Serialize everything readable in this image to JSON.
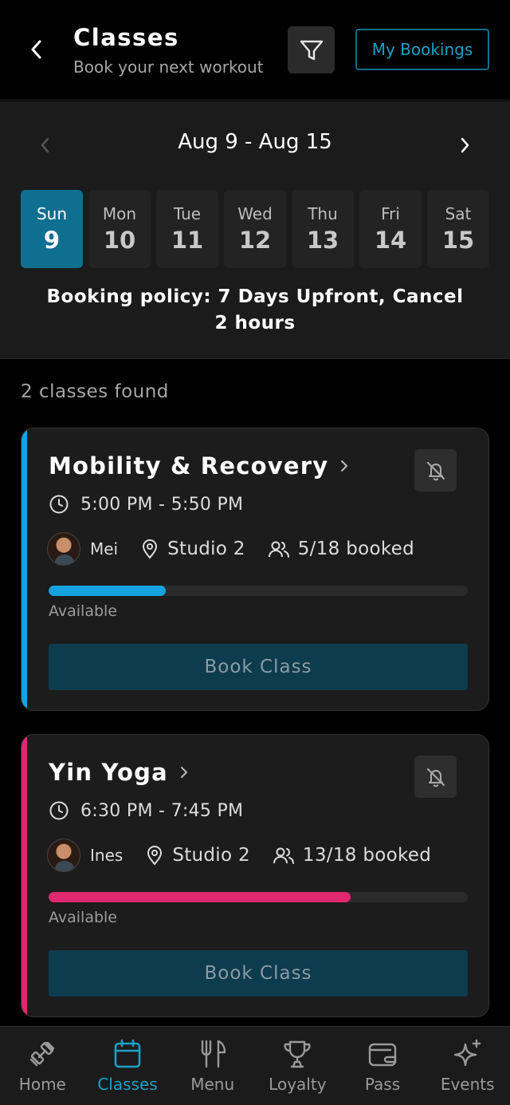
{
  "header": {
    "title": "Classes",
    "subtitle": "Book your next workout",
    "my_bookings_label": "My Bookings"
  },
  "week": {
    "range": "Aug 9 - Aug 15",
    "days": [
      {
        "name": "Sun",
        "num": "9",
        "active": true
      },
      {
        "name": "Mon",
        "num": "10",
        "active": false
      },
      {
        "name": "Tue",
        "num": "11",
        "active": false
      },
      {
        "name": "Wed",
        "num": "12",
        "active": false
      },
      {
        "name": "Thu",
        "num": "13",
        "active": false
      },
      {
        "name": "Fri",
        "num": "14",
        "active": false
      },
      {
        "name": "Sat",
        "num": "15",
        "active": false
      }
    ],
    "policy": "Booking policy: 7 Days Upfront, Cancel 2 hours"
  },
  "results": {
    "count_text": "2 classes found"
  },
  "classes": [
    {
      "title": "Mobility & Recovery",
      "time": "5:00 PM - 5:50 PM",
      "instructor": "Mei",
      "studio": "Studio 2",
      "booked": "5/18 booked",
      "fill_fraction": 0.28,
      "accent_color": "#14a3e0",
      "status": "Available",
      "book_label": "Book Class"
    },
    {
      "title": "Yin Yoga",
      "time": "6:30 PM - 7:45 PM",
      "instructor": "Ines",
      "studio": "Studio 2",
      "booked": "13/18 booked",
      "fill_fraction": 0.72,
      "accent_color": "#e0286f",
      "status": "Available",
      "book_label": "Book Class"
    }
  ],
  "nav": {
    "items": [
      {
        "label": "Home",
        "icon": "dumbbell-icon",
        "active": false
      },
      {
        "label": "Classes",
        "icon": "calendar-icon",
        "active": true
      },
      {
        "label": "Menu",
        "icon": "fork-knife-icon",
        "active": false
      },
      {
        "label": "Loyalty",
        "icon": "trophy-icon",
        "active": false
      },
      {
        "label": "Pass",
        "icon": "wallet-icon",
        "active": false
      },
      {
        "label": "Events",
        "icon": "sparkle-icon",
        "active": false
      }
    ]
  },
  "colors": {
    "primary": "#0e6f91",
    "accent_link": "#1d9fc7",
    "background": "#000000",
    "panel": "#1b1b1b"
  }
}
